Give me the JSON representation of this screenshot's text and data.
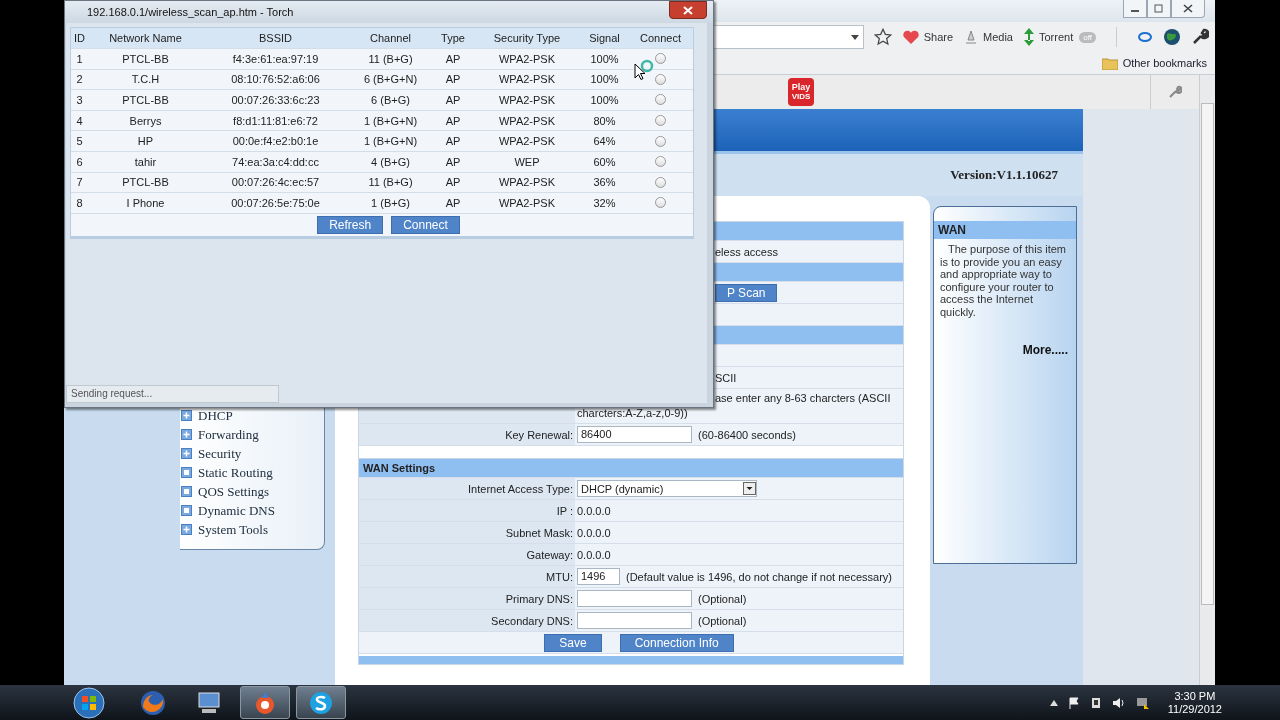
{
  "scan_window": {
    "title": "192.168.0.1/wireless_scan_ap.htm - Torch",
    "columns": [
      "ID",
      "Network Name",
      "BSSID",
      "Channel",
      "Type",
      "Security Type",
      "Signal",
      "Connect"
    ],
    "rows": [
      {
        "id": "1",
        "network_name": "PTCL-BB",
        "bssid": "f4:3e:61:ea:97:19",
        "channel": "11 (B+G)",
        "type": "AP",
        "security_type": "WPA2-PSK",
        "signal": "100%",
        "selected": false
      },
      {
        "id": "2",
        "network_name": "T.C.H",
        "bssid": "08:10:76:52:a6:06",
        "channel": "6 (B+G+N)",
        "type": "AP",
        "security_type": "WPA2-PSK",
        "signal": "100%",
        "selected": false
      },
      {
        "id": "3",
        "network_name": "PTCL-BB",
        "bssid": "00:07:26:33:6c:23",
        "channel": "6 (B+G)",
        "type": "AP",
        "security_type": "WPA2-PSK",
        "signal": "100%",
        "selected": false
      },
      {
        "id": "4",
        "network_name": "Berrys",
        "bssid": "f8:d1:11:81:e6:72",
        "channel": "1 (B+G+N)",
        "type": "AP",
        "security_type": "WPA2-PSK",
        "signal": "80%",
        "selected": false
      },
      {
        "id": "5",
        "network_name": "HP",
        "bssid": "00:0e:f4:e2:b0:1e",
        "channel": "1 (B+G+N)",
        "type": "AP",
        "security_type": "WPA2-PSK",
        "signal": "64%",
        "selected": false
      },
      {
        "id": "6",
        "network_name": "tahir",
        "bssid": "74:ea:3a:c4:dd:cc",
        "channel": "4 (B+G)",
        "type": "AP",
        "security_type": "WEP",
        "signal": "60%",
        "selected": false
      },
      {
        "id": "7",
        "network_name": "PTCL-BB",
        "bssid": "00:07:26:4c:ec:57",
        "channel": "11 (B+G)",
        "type": "AP",
        "security_type": "WPA2-PSK",
        "signal": "36%",
        "selected": false
      },
      {
        "id": "8",
        "network_name": "I Phone",
        "bssid": "00:07:26:5e:75:0e",
        "channel": "1 (B+G)",
        "type": "AP",
        "security_type": "WPA2-PSK",
        "signal": "32%",
        "selected": false
      }
    ],
    "buttons": [
      "Refresh",
      "Connect"
    ],
    "status": "Sending request..."
  },
  "browser": {
    "toolbar": [
      "Share",
      "Media",
      "Torrent"
    ],
    "torrent_toggle": {
      "label": "off",
      "on": false
    },
    "bookmarks": [
      "Other bookmarks"
    ],
    "extension": {
      "line1": "Play",
      "line2": "VIDS"
    }
  },
  "router": {
    "version": "Version:V1.1.10627",
    "menu": [
      {
        "label": "DHCP",
        "kind": "group"
      },
      {
        "label": "Forwarding",
        "kind": "group"
      },
      {
        "label": "Security",
        "kind": "group"
      },
      {
        "label": "Static Routing",
        "kind": "page"
      },
      {
        "label": "QOS Settings",
        "kind": "page"
      },
      {
        "label": "Dynamic DNS",
        "kind": "page"
      },
      {
        "label": "System Tools",
        "kind": "group"
      }
    ],
    "wireless_rows": [
      {
        "kind": "header"
      },
      {
        "kind": "text",
        "value": "eless access"
      },
      {
        "kind": "header"
      },
      {
        "kind": "button",
        "value": "P Scan"
      },
      {
        "kind": "blank"
      },
      {
        "kind": "header"
      },
      {
        "kind": "blank"
      },
      {
        "kind": "text",
        "value": "SCII"
      },
      {
        "kind": "note",
        "lines": [
          "ase enter any 8-63 charcters (ASCII",
          "charcters:A-Z,a-z,0-9))"
        ]
      },
      {
        "kind": "input",
        "label": "Key Renewal:",
        "value": "86400",
        "hint": "(60-86400 seconds)"
      }
    ],
    "wan_title": "WAN Settings",
    "wan_rows": [
      {
        "kind": "select",
        "label": "Internet Access Type:",
        "value": "DHCP (dynamic)"
      },
      {
        "kind": "text",
        "label": "IP :",
        "value": "0.0.0.0"
      },
      {
        "kind": "text",
        "label": "Subnet Mask:",
        "value": "0.0.0.0"
      },
      {
        "kind": "text",
        "label": "Gateway:",
        "value": "0.0.0.0"
      },
      {
        "kind": "short_input",
        "label": "MTU:",
        "value": "1496",
        "hint": "(Default value is 1496, do not change if not necessary)"
      },
      {
        "kind": "input",
        "label": "Primary DNS:",
        "hint": "(Optional)"
      },
      {
        "kind": "input",
        "label": "Secondary DNS:",
        "hint": "(Optional)"
      }
    ],
    "wan_buttons": [
      "Save",
      "Connection Info"
    ],
    "help": {
      "title": "WAN",
      "text": "The purpose of this item is to provide you an easy and appropriate way to configure your router to access the Internet quickly.",
      "more": "More....."
    }
  },
  "taskbar": {
    "time": "3:30 PM",
    "date": "11/29/2012"
  }
}
